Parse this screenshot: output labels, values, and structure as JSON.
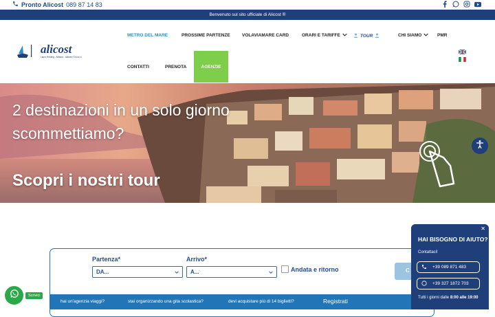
{
  "topbar": {
    "phone_label": "Pronto Alicost",
    "phone_number": "089 87 14 83",
    "social": [
      "facebook-icon",
      "whatsapp-icon",
      "instagram-icon",
      "youtube-icon"
    ]
  },
  "banner": {
    "text": "Benvenuto sul sito ufficiale di Alicost ®"
  },
  "logo": {
    "brand": "alicost",
    "tagline": "Lauro Holding - Alilauro - Alilauro Gru.so.n."
  },
  "nav": {
    "metro": "METRO DEL MARE",
    "partenze": "PROSSIME PARTENZE",
    "card": "VOLAVIAMARE CARD",
    "orari": "ORARI E TARIFFE",
    "tour": "TOUR",
    "chi": "CHI SIAMO",
    "pmr": "PMR",
    "contatti": "CONTATTI",
    "prenota": "PRENOTA",
    "agenzie": "AGENZIE"
  },
  "hero": {
    "title_line1": "2 destinazioni in un solo giorno",
    "title_line2": "scommettiamo?",
    "cta": "Scopri i nostri tour"
  },
  "booking": {
    "from_label": "Partenza*",
    "from_value": "DA...",
    "to_label": "Arrivo*",
    "to_value": "A...",
    "roundtrip_label": "Andata e ritorno",
    "search_partial": "C",
    "links": {
      "agency": "hai un'agenzia viaggi?",
      "school": "stai organizzando una gita scolastica?",
      "bulk": "devi acquistare più di 14 biglietti?",
      "register": "Registrati"
    }
  },
  "help": {
    "title": "HAI BISOGNO DI AIUTO?",
    "subtitle": "Contattaci!",
    "phone": "+39 089 871 483",
    "whatsapp": "+39 327 1872 703",
    "hours_prefix": "Tutti i giorni dalle",
    "hours_value": "8:00 alle 19:00"
  },
  "whatsapp_widget": {
    "label": "Scrivici"
  },
  "colors": {
    "brand": "#1f3f7a",
    "accent": "#2a8fc9",
    "green": "#7fce4b",
    "whatsapp": "#2ba84a"
  }
}
